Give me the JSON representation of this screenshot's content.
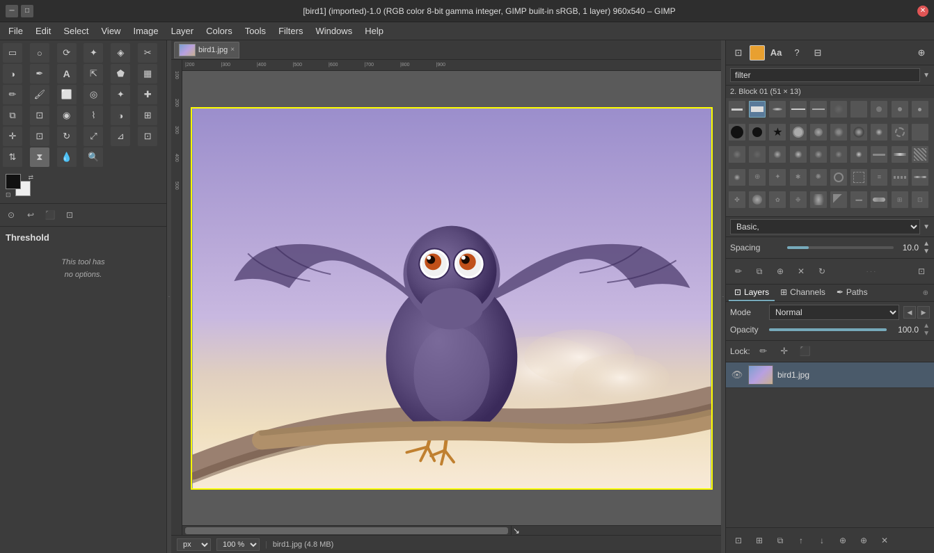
{
  "titleBar": {
    "title": "[bird1] (imported)-1.0 (RGB color 8-bit gamma integer, GIMP built-in sRGB, 1 layer) 960x540 – GIMP"
  },
  "menuBar": {
    "items": [
      "File",
      "Edit",
      "Select",
      "View",
      "Image",
      "Layer",
      "Colors",
      "Tools",
      "Filters",
      "Windows",
      "Help"
    ]
  },
  "toolbox": {
    "tools": [
      {
        "name": "rect-select",
        "symbol": "⬜"
      },
      {
        "name": "ellipse-select",
        "symbol": "⭕"
      },
      {
        "name": "lasso",
        "symbol": "🔵"
      },
      {
        "name": "fuzzy-select",
        "symbol": "✦"
      },
      {
        "name": "by-color-select",
        "symbol": "⬛"
      },
      {
        "name": "scissors",
        "symbol": "✂"
      },
      {
        "name": "foreground-select",
        "symbol": "◑"
      },
      {
        "name": "path-tool",
        "symbol": "✒"
      },
      {
        "name": "text-tool",
        "symbol": "A"
      },
      {
        "name": "measure-tool",
        "symbol": "◻"
      },
      {
        "name": "bucket-fill",
        "symbol": "🪣"
      },
      {
        "name": "blend-tool",
        "symbol": "▦"
      },
      {
        "name": "pencil",
        "symbol": "✏"
      },
      {
        "name": "paintbrush",
        "symbol": "🖌"
      },
      {
        "name": "eraser",
        "symbol": "⬜"
      },
      {
        "name": "airbrush",
        "symbol": "💨"
      },
      {
        "name": "ink-tool",
        "symbol": "🖊"
      },
      {
        "name": "heal-tool",
        "symbol": "✚"
      },
      {
        "name": "clone-tool",
        "symbol": "⧉"
      },
      {
        "name": "perspective-clone",
        "symbol": "⧉"
      },
      {
        "name": "blur-sharpen",
        "symbol": "◎"
      },
      {
        "name": "smudge",
        "symbol": "⌇"
      },
      {
        "name": "dodge-burn",
        "symbol": "◑"
      },
      {
        "name": "align",
        "symbol": "⊞"
      },
      {
        "name": "move",
        "symbol": "✛"
      },
      {
        "name": "crop",
        "symbol": "⊡"
      },
      {
        "name": "rotate",
        "symbol": "↻"
      },
      {
        "name": "scale",
        "symbol": "⤢"
      },
      {
        "name": "shear",
        "symbol": "⊿"
      },
      {
        "name": "perspective",
        "symbol": "⊡"
      },
      {
        "name": "flip",
        "symbol": "⇅"
      },
      {
        "name": "threshold",
        "symbol": "⧗"
      },
      {
        "name": "color-picker",
        "symbol": "💧"
      },
      {
        "name": "zoom",
        "symbol": "🔍"
      }
    ],
    "toolOptions": {
      "toolName": "Threshold",
      "noOptionsText": "This tool has\nno options."
    }
  },
  "brushPanel": {
    "filterPlaceholder": "filter",
    "brushName": "2. Block 01 (51 × 13)",
    "presetLabel": "Basic,",
    "spacing": {
      "label": "Spacing",
      "value": "10.0"
    }
  },
  "layersPanel": {
    "tabs": [
      {
        "name": "Layers",
        "icon": "layers-icon",
        "active": true
      },
      {
        "name": "Channels",
        "icon": "channels-icon",
        "active": false
      },
      {
        "name": "Paths",
        "icon": "paths-icon",
        "active": false
      }
    ],
    "mode": {
      "label": "Mode",
      "value": "Normal"
    },
    "opacity": {
      "label": "Opacity",
      "value": "100.0"
    },
    "lock": {
      "label": "Lock:"
    },
    "layers": [
      {
        "name": "bird1.jpg",
        "visible": true
      }
    ]
  },
  "statusBar": {
    "unit": "px",
    "zoom": "100 %",
    "filename": "bird1.jpg (4.8 MB)"
  },
  "imageTab": {
    "name": "bird1.jpg",
    "closeSymbol": "×"
  },
  "rulers": {
    "horizontal": [
      "200",
      "300",
      "400",
      "500",
      "600",
      "700",
      "800",
      "900"
    ],
    "vertical": [
      "100",
      "200",
      "300",
      "400",
      "500"
    ]
  }
}
